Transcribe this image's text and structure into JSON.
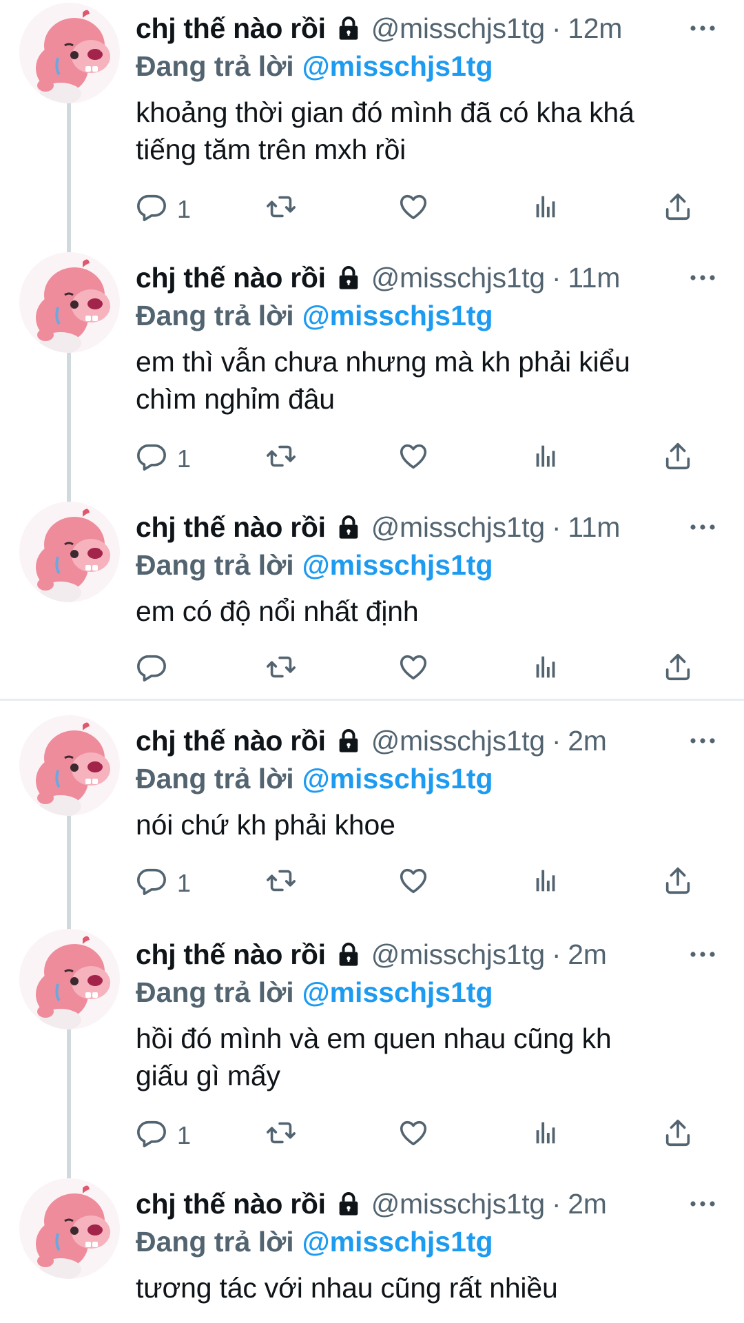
{
  "tweets": [
    {
      "display_name": "chj thế nào rồi",
      "handle": "@misschjs1tg",
      "time": "12m",
      "reply_label": "Đang trả lời",
      "reply_to": "@misschjs1tg",
      "text": [
        "khoảng thời gian đó mình đã có kha khá",
        "tiếng tăm trên mxh rồi"
      ],
      "reply_count": "1"
    },
    {
      "display_name": "chj thế nào rồi",
      "handle": "@misschjs1tg",
      "time": "11m",
      "reply_label": "Đang trả lời",
      "reply_to": "@misschjs1tg",
      "text": [
        "em thì vẫn chưa nhưng mà kh phải kiểu",
        "chìm nghỉm đâu"
      ],
      "reply_count": "1"
    },
    {
      "display_name": "chj thế nào rồi",
      "handle": "@misschjs1tg",
      "time": "11m",
      "reply_label": "Đang trả lời",
      "reply_to": "@misschjs1tg",
      "text": [
        "em có độ nổi nhất định"
      ],
      "reply_count": ""
    },
    {
      "display_name": "chj thế nào rồi",
      "handle": "@misschjs1tg",
      "time": "2m",
      "reply_label": "Đang trả lời",
      "reply_to": "@misschjs1tg",
      "text": [
        "nói chứ kh phải khoe"
      ],
      "reply_count": "1"
    },
    {
      "display_name": "chj thế nào rồi",
      "handle": "@misschjs1tg",
      "time": "2m",
      "reply_label": "Đang trả lời",
      "reply_to": "@misschjs1tg",
      "text": [
        "hồi đó mình và em quen nhau cũng kh",
        "giấu gì mấy"
      ],
      "reply_count": "1"
    },
    {
      "display_name": "chj thế nào rồi",
      "handle": "@misschjs1tg",
      "time": "2m",
      "reply_label": "Đang trả lời",
      "reply_to": "@misschjs1tg",
      "text": [
        "tương tác với nhau cũng rất nhiều"
      ],
      "reply_count": ""
    }
  ],
  "icons": {
    "lock": "lock-icon",
    "more": "more-icon",
    "reply": "reply-icon",
    "retweet": "retweet-icon",
    "like": "like-icon",
    "stats": "stats-icon",
    "share": "share-icon",
    "avatar": "pink-beaver-avatar"
  },
  "colors": {
    "mention": "#1d9bf0",
    "muted": "#536471",
    "text": "#0f1419",
    "thread_line": "#cfd9de"
  }
}
